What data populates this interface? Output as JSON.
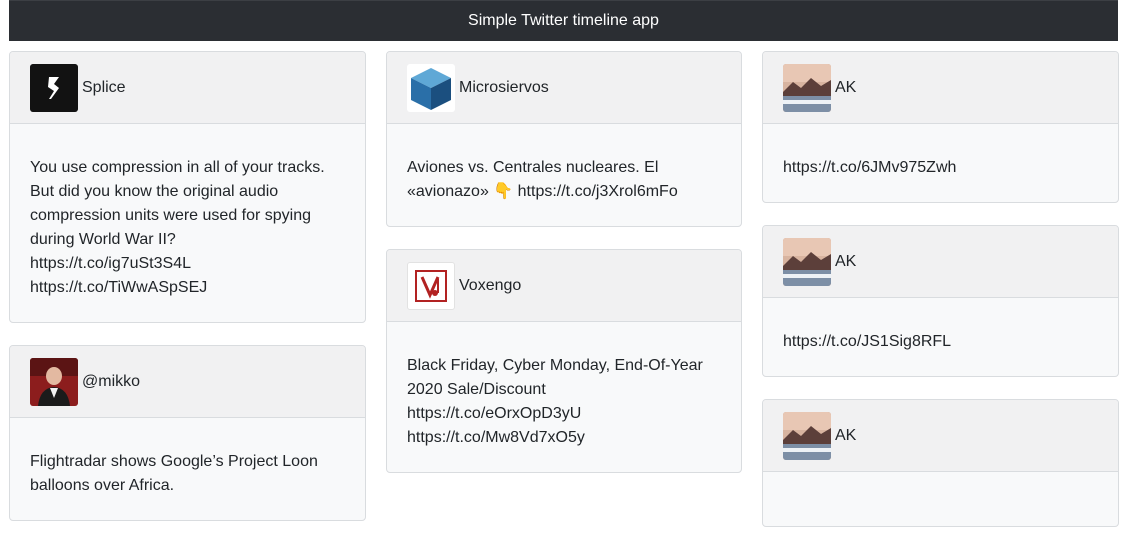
{
  "navbar": {
    "title": "Simple Twitter timeline app"
  },
  "columns": [
    {
      "cards": [
        {
          "user": "Splice",
          "avatar_icon": "splice-logo-icon",
          "text": "You use compression in all of your tracks.\nBut did you know the original audio\ncompression units were used for spying\nduring World War II?\nhttps://t.co/ig7uSt3S4L\nhttps://t.co/TiWwASpSEJ"
        },
        {
          "user": "@mikko",
          "avatar_icon": "mikko-profile-photo-icon",
          "text": "Flightradar shows Google’s Project Loon\nballoons over Africa."
        }
      ]
    },
    {
      "cards": [
        {
          "user": "Microsiervos",
          "avatar_icon": "blue-cube-icon",
          "text": "Aviones vs. Centrales nucleares. El\n«avionazo» 👇 https://t.co/j3Xrol6mFo"
        },
        {
          "user": "Voxengo",
          "avatar_icon": "voxengo-logo-icon",
          "text": "Black Friday, Cyber Monday, End-Of-Year\n2020 Sale/Discount\nhttps://t.co/eOrxOpD3yU\nhttps://t.co/Mw8Vd7xO5y"
        }
      ]
    },
    {
      "cards": [
        {
          "user": "AK",
          "avatar_icon": "landscape-photo-icon",
          "text": "https://t.co/6JMv975Zwh"
        },
        {
          "user": "AK",
          "avatar_icon": "landscape-photo-icon",
          "text": "https://t.co/JS1Sig8RFL"
        },
        {
          "user": "AK",
          "avatar_icon": "landscape-photo-icon",
          "text": ""
        }
      ]
    }
  ]
}
